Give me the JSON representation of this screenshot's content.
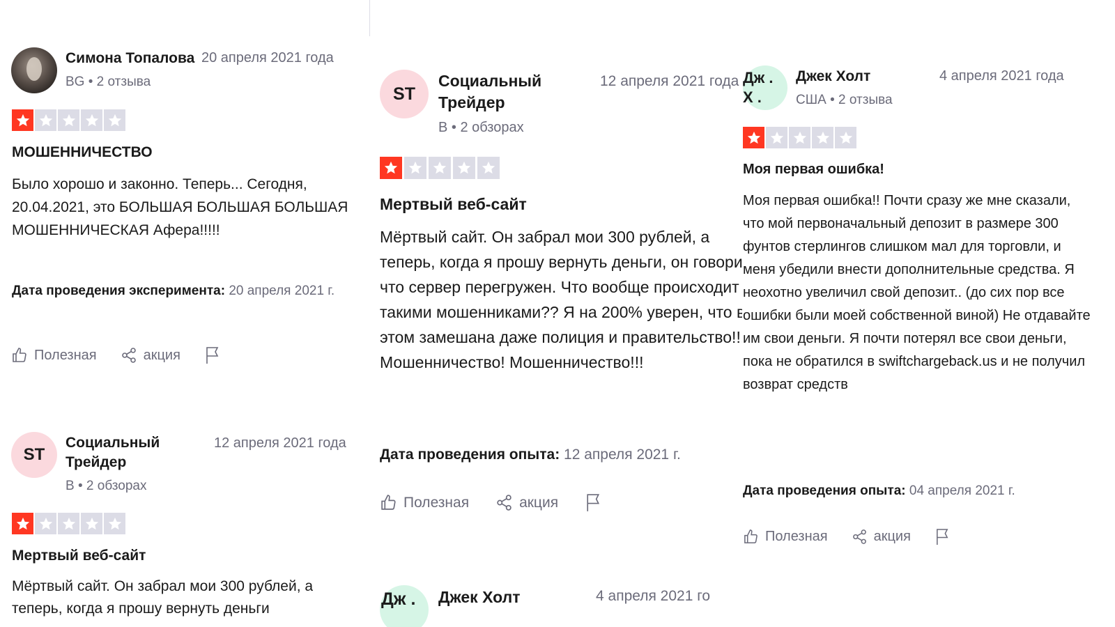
{
  "reviews": {
    "r1": {
      "name": "Симона Топалова",
      "date": "20 апреля 2021 года",
      "country": "BG",
      "count": "2 отзыва",
      "rating": 1,
      "title": "МОШЕННИЧЕСТВО",
      "text": "Было хорошо и законно. Теперь... Сегодня, 20.04.2021, это БОЛЬШАЯ БОЛЬШАЯ БОЛЬШАЯ МОШЕННИЧЕСКАЯ Афера!!!!!",
      "exp_label": "Дата проведения эксперимента:",
      "exp_value": "20 апреля 2021 г."
    },
    "r2": {
      "initials": "ST",
      "name": "Социальный Трейдер",
      "date": "12 апреля 2021 года",
      "country": "В",
      "count": "2 обзорах",
      "rating": 1,
      "title": "Мертвый веб-сайт",
      "text": "Мёртвый сайт. Он забрал мои 300 рублей, а теперь, когда я прошу вернуть деньги"
    },
    "r3": {
      "initials": "ST",
      "name": "Социальный Трейдер",
      "date": "12 апреля 2021 года",
      "country": "В",
      "count": "2 обзорах",
      "rating": 1,
      "title": "Мертвый веб-сайт",
      "text": "Мёртвый сайт. Он забрал мои 300 рублей, а теперь, когда я прошу вернуть деньги, он говорит, что сервер перегружен. Что вообще происходит с такими мошенниками?? Я на 200% уверен, что в этом замешана даже полиция и правительство!!! Мошенничество! Мошенничество!!!",
      "exp_label": "Дата проведения опыта:",
      "exp_value": "12 апреля 2021 г."
    },
    "r4": {
      "initials": "Дж . Х .",
      "name": "Джек Холт",
      "date": "4 апреля 2021 года",
      "country": "США",
      "count": "2 отзыва",
      "rating": 1,
      "title": "Моя первая ошибка!",
      "text": "Моя первая ошибка!! Почти сразу же мне сказали, что мой первоначальный депозит в размере 300 фунтов стерлингов слишком мал для торговли, и меня убедили внести дополнительные средства. Я неохотно увеличил свой депозит.. (до сих пор все ошибки были моей собственной виной) Не отдавайте им свои деньги. Я почти потерял все свои деньги, пока не обратился в swiftchargeback.us и не получил возврат средств",
      "exp_label": "Дата проведения опыта:",
      "exp_value": "04 апреля 2021 г."
    },
    "r5": {
      "initials": "Дж .",
      "name": "Джек Холт",
      "date": "4 апреля 2021 го"
    }
  },
  "actions": {
    "useful": "Полезная",
    "share": "акция"
  },
  "colors": {
    "star_on": "#ff3722",
    "star_off": "#dcdce6",
    "avatar_pink": "#fbd9de",
    "avatar_green": "#d6f5e6"
  }
}
